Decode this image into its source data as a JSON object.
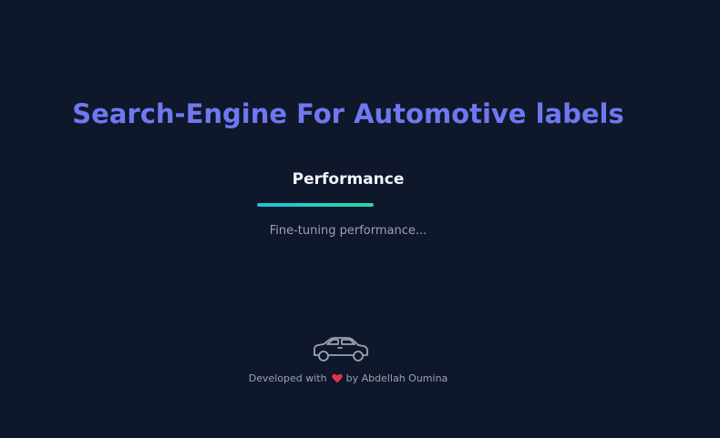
{
  "app": {
    "title": "Search-Engine For Automotive labels"
  },
  "loader": {
    "step_label": "Performance",
    "status_text": "Fine-tuning performance...",
    "progress_percent": 100
  },
  "footer": {
    "prefix": "Developed with",
    "suffix": "by Abdellah Oumina",
    "heart_icon": "heart-icon",
    "car_icon": "car-icon"
  },
  "colors": {
    "background": "#0f172a",
    "title": "#6f78f0",
    "progress_start": "#22c5d8",
    "progress_end": "#2dd4a4",
    "heart": "#e0344e"
  }
}
